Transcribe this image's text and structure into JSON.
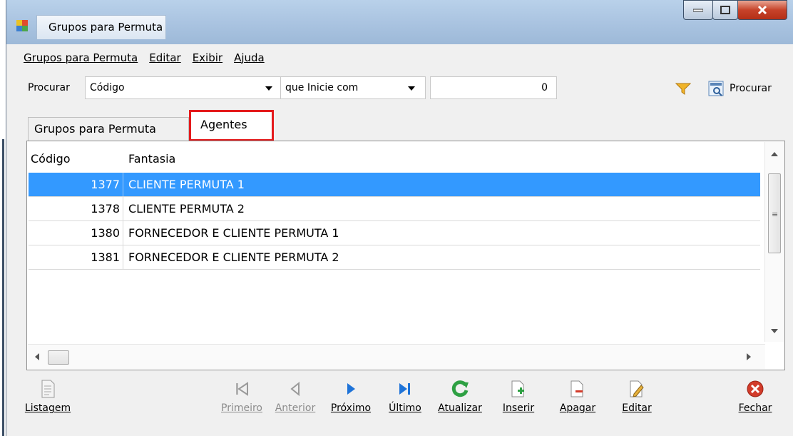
{
  "window": {
    "title": "Grupos para Permuta"
  },
  "menu": [
    "Grupos para Permuta",
    "Editar",
    "Exibir",
    "Ajuda"
  ],
  "search": {
    "label": "Procurar",
    "field": "Código",
    "condition": "que Inicie com",
    "value": "0",
    "button": "Procurar"
  },
  "tabs": [
    {
      "label": "Grupos para Permuta",
      "active": false
    },
    {
      "label": "Agentes",
      "active": true
    }
  ],
  "grid": {
    "columns": [
      "Código",
      "Fantasia"
    ],
    "rows": [
      {
        "code": "1377",
        "name": "CLIENTE PERMUTA 1",
        "selected": true
      },
      {
        "code": "1378",
        "name": "CLIENTE PERMUTA 2",
        "selected": false
      },
      {
        "code": "1380",
        "name": "FORNECEDOR E CLIENTE PERMUTA 1",
        "selected": false
      },
      {
        "code": "1381",
        "name": "FORNECEDOR E CLIENTE PERMUTA 2",
        "selected": false
      }
    ]
  },
  "toolbar": {
    "listagem": "Listagem",
    "primeiro": "Primeiro",
    "anterior": "Anterior",
    "proximo": "Próximo",
    "ultimo": "Último",
    "atualizar": "Atualizar",
    "inserir": "Inserir",
    "apagar": "Apagar",
    "editar": "Editar",
    "fechar": "Fechar"
  },
  "colors": {
    "selection": "#3399ff",
    "tab_highlight": "#e41a1c",
    "nav_blue": "#1e73d8",
    "refresh_green": "#2ea043",
    "close_red": "#d23b2a"
  }
}
